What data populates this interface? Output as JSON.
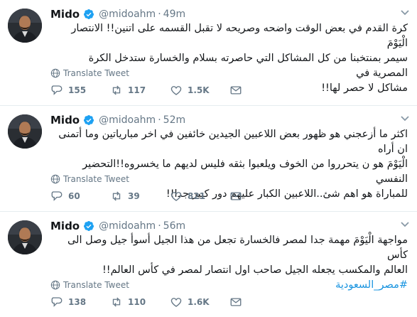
{
  "tweets": [
    {
      "name": "Mido",
      "handle": "@midoahm",
      "time": "49m",
      "text_lines": [
        "كرة القدم في بعض الوقت واضحه وصريحه لا تقبل القسمه على اتنين!! الانتصار الْيَوْمَ",
        "سيمر بمنتخبنا من كل المشاكل التي حاصرته بسلام والخسارة ستدخل الكرة المصرية في",
        "مشاكل لا حصر لها!!"
      ],
      "translate_label": "Translate Tweet",
      "replies": "155",
      "retweets": "117",
      "likes": "1.5K"
    },
    {
      "name": "Mido",
      "handle": "@midoahm",
      "time": "52m",
      "text_lines": [
        "اكثر ما أزعجني هو ظهور بعض اللاعبين الجيدين خائفين في اخر مبارياتين وما أتمنى ان أراه",
        "الْيَوْمَ هو ن يتحرروا من الخوف ويلعبوا بثقه فليس لديهم ما يخسروه!!التحضير النفسي",
        "للمباراة هو اهم شئ..اللاعبين الكبار عليهم دور كبير جدا!!"
      ],
      "translate_label": "Translate Tweet",
      "replies": "60",
      "retweets": "39",
      "likes": "821"
    },
    {
      "name": "Mido",
      "handle": "@midoahm",
      "time": "56m",
      "text_lines": [
        "مواجهة الْيَوْمَ مهمة جدا لمصر فالخسارة تجعل من هذا الجيل أسوأ جيل وصل الى كأس",
        "العالم والمكسب يجعله الجيل صاحب اول انتصار لمصر في كأس العالم!!"
      ],
      "hashtag": "#مصر_السعودية",
      "translate_label": "Translate Tweet",
      "replies": "138",
      "retweets": "110",
      "likes": "1.6K"
    }
  ],
  "icons": {
    "verified": "verified-badge-icon",
    "caret": "chevron-down-icon",
    "translate": "globe-icon",
    "reply": "reply-icon",
    "retweet": "retweet-icon",
    "like": "heart-icon",
    "message": "envelope-icon"
  },
  "colors": {
    "verified": "#1da1f2",
    "hashtag": "#1b95e0",
    "muted": "#657786",
    "text": "#14171a",
    "divider": "#e6ecf0"
  }
}
